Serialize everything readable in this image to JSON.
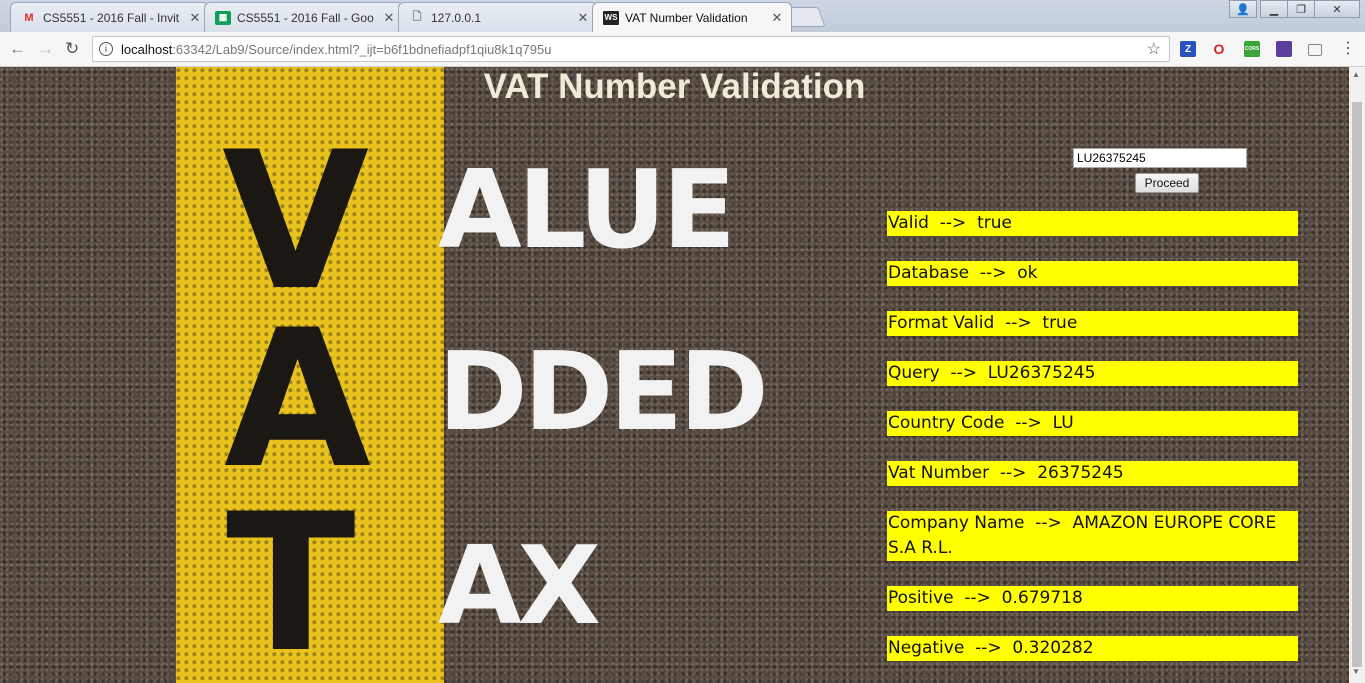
{
  "browser": {
    "tabs": [
      {
        "title": "CS5551 - 2016 Fall - Invit",
        "icon": "gmail-icon",
        "color": "#d93025"
      },
      {
        "title": "CS5551 - 2016 Fall - Goo",
        "icon": "sheets-icon",
        "color": "#0f9d58"
      },
      {
        "title": "127.0.0.1",
        "icon": "page-icon",
        "color": "#777777"
      },
      {
        "title": "VAT Number Validation",
        "icon": "webstorm-icon",
        "color": "#222222"
      }
    ],
    "url_host": "localhost",
    "url_path": ":63342/Lab9/Source/index.html?_ijt=b6f1bdnefiadpf1qiu8k1q795u",
    "extensions": [
      {
        "label": "Z",
        "color": "#2a52be"
      },
      {
        "label": "O",
        "color": "#d41f1f"
      },
      {
        "label": "CORS",
        "color": "#3aa33a"
      },
      {
        "label": "",
        "color": "#5a3e9a"
      },
      {
        "label": "",
        "color": "#888888"
      }
    ]
  },
  "page": {
    "title": "VAT Number Validation",
    "input_value": "LU26375245",
    "proceed_label": "Proceed",
    "background_letters": [
      "V",
      "A",
      "T"
    ],
    "background_words": [
      "ALUE",
      "DDED",
      "AX"
    ],
    "results": [
      "Valid  -->  true",
      "Database  -->  ok",
      "Format Valid  -->  true",
      "Query  -->  LU26375245",
      "Country Code  -->  LU",
      "Vat Number  -->  26375245",
      "Company Name  -->  AMAZON EUROPE CORE S.A R.L.",
      "Positive  -->  0.679718",
      "Negative  -->  0.320282"
    ],
    "highlight_color": "#ffff00"
  }
}
